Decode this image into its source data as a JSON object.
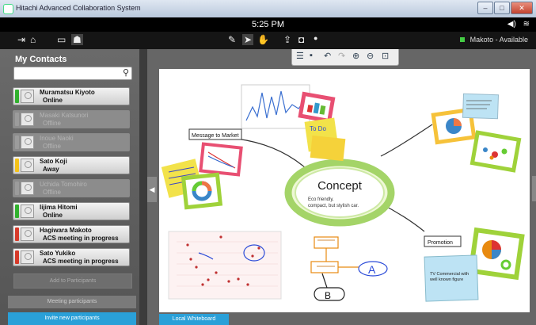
{
  "window": {
    "title": "Hitachi Advanced Collaboration System",
    "buttons": [
      "–",
      "□",
      "✕"
    ]
  },
  "statusbar": {
    "time": "5:25 PM"
  },
  "user": {
    "name": "Makoto",
    "separator": "-",
    "status": "Available"
  },
  "sidebar": {
    "title": "My Contacts",
    "search": {
      "value": "",
      "placeholder": ""
    },
    "contacts": [
      {
        "name": "Muramatsu Kiyoto",
        "status": "Online",
        "state": "online",
        "color": "#31b12e"
      },
      {
        "name": "Masaki Katsunori",
        "status": "Offline",
        "state": "offline",
        "color": "#9c9c9c"
      },
      {
        "name": "Inoue Naoki",
        "status": "Offline",
        "state": "offline",
        "color": "#9c9c9c"
      },
      {
        "name": "Sato Koji",
        "status": "Away",
        "state": "away",
        "color": "#f4c21a"
      },
      {
        "name": "Uchida Tomohiro",
        "status": "Offline",
        "state": "offline",
        "color": "#9c9c9c"
      },
      {
        "name": "Iijima Hitomi",
        "status": "Online",
        "state": "online",
        "color": "#31b12e"
      },
      {
        "name": "Hagiwara Makoto",
        "status": "ACS meeting in progress",
        "state": "busy",
        "color": "#d63a2a"
      },
      {
        "name": "Sato Yukiko",
        "status": "ACS meeting in progress",
        "state": "busy",
        "color": "#d63a2a"
      }
    ],
    "add_button": "Add to Participants",
    "meeting_button": "Meeting participants",
    "invite_button": "Invite new participants"
  },
  "whiteboard": {
    "tab_label": "Local Whiteboard",
    "concept_title": "Concept",
    "concept_text": [
      "Eco friendly,",
      "compact, but stylish car."
    ],
    "message_label": "Message to Market",
    "promotion_label": "Promotion",
    "tv_note": [
      "TV Commercial with",
      "well known figure"
    ],
    "handwriting": [
      "A",
      "B"
    ]
  },
  "colors": {
    "accent": "#2aa0d8",
    "online": "#31b12e",
    "away": "#f4c21a",
    "busy": "#d63a2a",
    "sticky_yellow": "#f2e24a",
    "sticky_green": "#9fd23a",
    "sticky_blue": "#bde3f4"
  }
}
